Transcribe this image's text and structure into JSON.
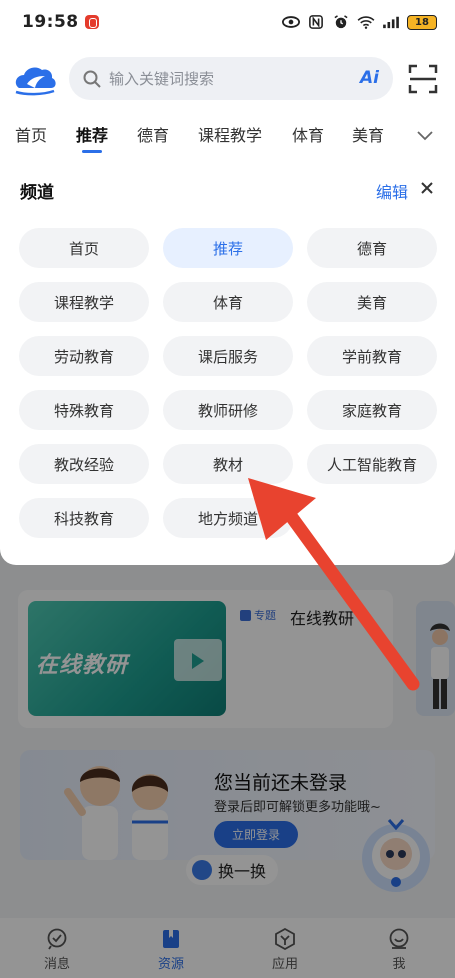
{
  "status_bar": {
    "time": "19:58",
    "battery": "18"
  },
  "header": {
    "search_placeholder": "输入关键词搜索",
    "ai_label": "Ai"
  },
  "tabs": [
    {
      "label": "首页",
      "active": false
    },
    {
      "label": "推荐",
      "active": true
    },
    {
      "label": "德育",
      "active": false
    },
    {
      "label": "课程教学",
      "active": false
    },
    {
      "label": "体育",
      "active": false
    },
    {
      "label": "美育",
      "active": false
    }
  ],
  "channel_panel": {
    "title": "频道",
    "edit_label": "编辑",
    "channels": [
      {
        "label": "首页",
        "selected": false
      },
      {
        "label": "推荐",
        "selected": true
      },
      {
        "label": "德育",
        "selected": false
      },
      {
        "label": "课程教学",
        "selected": false
      },
      {
        "label": "体育",
        "selected": false
      },
      {
        "label": "美育",
        "selected": false
      },
      {
        "label": "劳动教育",
        "selected": false
      },
      {
        "label": "课后服务",
        "selected": false
      },
      {
        "label": "学前教育",
        "selected": false
      },
      {
        "label": "特殊教育",
        "selected": false
      },
      {
        "label": "教师研修",
        "selected": false
      },
      {
        "label": "家庭教育",
        "selected": false
      },
      {
        "label": "教改经验",
        "selected": false
      },
      {
        "label": "教材",
        "selected": false
      },
      {
        "label": "人工智能教育",
        "selected": false
      },
      {
        "label": "科技教育",
        "selected": false
      },
      {
        "label": "地方频道",
        "selected": false
      }
    ]
  },
  "background_content": {
    "banner_text": "在线教研",
    "topic_tag": "专题",
    "topic_title": "在线教研",
    "login_title": "您当前还未登录",
    "login_subtitle": "登录后即可解锁更多功能哦~",
    "login_button": "立即登录",
    "swap_label": "换一换"
  },
  "bottom_nav": [
    {
      "label": "消息",
      "icon": "message-icon",
      "active": false
    },
    {
      "label": "资源",
      "icon": "book-icon",
      "active": true
    },
    {
      "label": "应用",
      "icon": "apps-icon",
      "active": false
    },
    {
      "label": "我",
      "icon": "profile-icon",
      "active": false
    }
  ],
  "colors": {
    "accent": "#2b6fe8",
    "annotation_arrow": "#e8432f"
  }
}
